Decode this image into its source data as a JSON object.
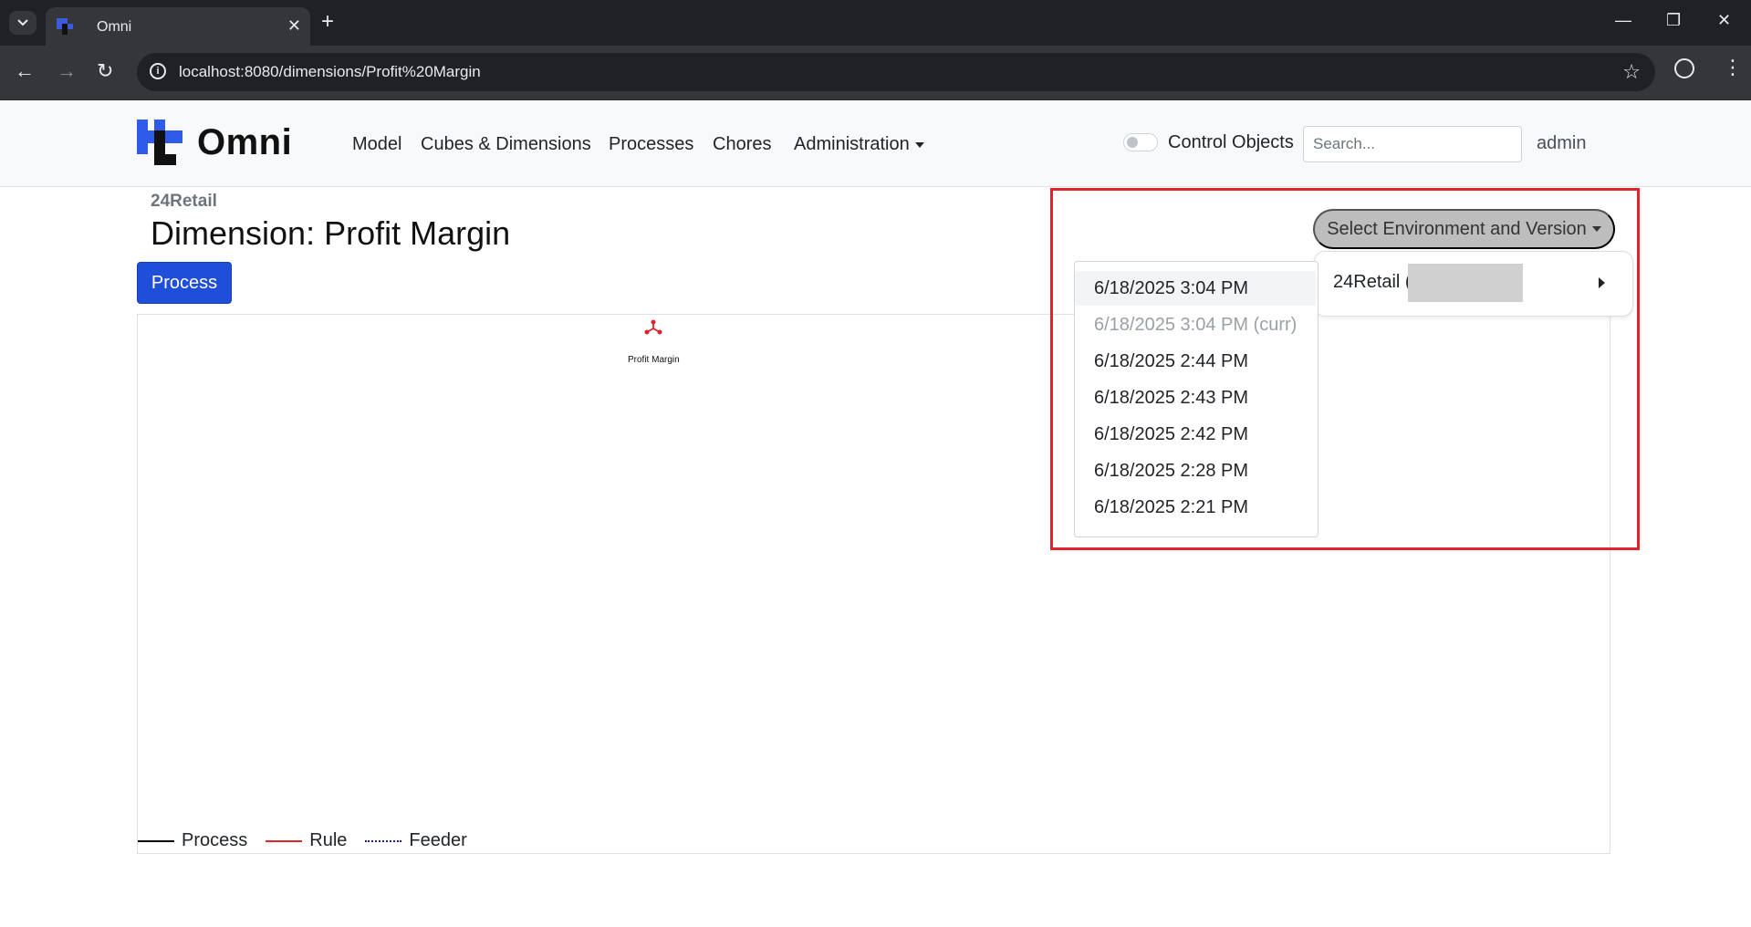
{
  "browser": {
    "tab_title": "Omni",
    "url": "localhost:8080/dimensions/Profit%20Margin"
  },
  "navbar": {
    "brand": "Omni",
    "links": [
      "Model",
      "Cubes & Dimensions",
      "Processes",
      "Chores",
      "Administration"
    ],
    "control_objects_label": "Control Objects",
    "control_objects_enabled": false,
    "search_placeholder": "Search...",
    "user": "admin"
  },
  "page": {
    "breadcrumb": "24Retail",
    "title": "Dimension: Profit Margin",
    "process_button": "Process"
  },
  "graph": {
    "node_label": "Profit Margin",
    "node_color": "#e0242b",
    "legend": [
      {
        "label": "Process",
        "color": "#000000",
        "style": "solid"
      },
      {
        "label": "Rule",
        "color": "#e0242b",
        "style": "solid"
      },
      {
        "label": "Feeder",
        "color": "#1a1aa6",
        "style": "dotted"
      }
    ]
  },
  "environment": {
    "button_label": "Select Environment and Version",
    "environment_item": "24Retail (",
    "versions": [
      "6/18/2025 3:04 PM",
      "6/18/2025 3:04 PM (curr)",
      "6/18/2025 2:44 PM",
      "6/18/2025 2:43 PM",
      "6/18/2025 2:42 PM",
      "6/18/2025 2:28 PM",
      "6/18/2025 2:21 PM"
    ]
  }
}
